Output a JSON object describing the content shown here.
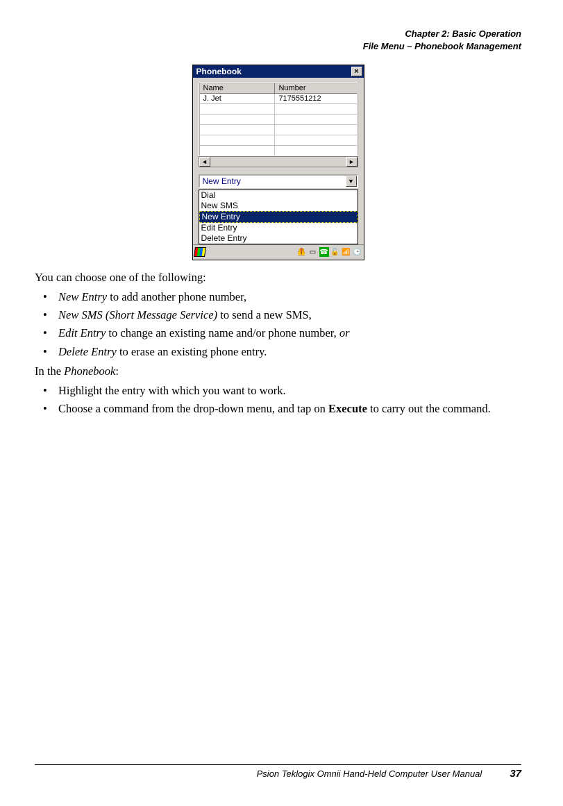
{
  "header": {
    "line1": "Chapter 2: Basic Operation",
    "line2": "File Menu – Phonebook Management"
  },
  "phonebook": {
    "title": "Phonebook",
    "close_glyph": "×",
    "columns": {
      "name": "Name",
      "number": "Number"
    },
    "rows": [
      {
        "name": "J. Jet",
        "number": "7175551212"
      },
      {
        "name": "",
        "number": ""
      },
      {
        "name": "",
        "number": ""
      },
      {
        "name": "",
        "number": ""
      },
      {
        "name": "",
        "number": ""
      },
      {
        "name": "",
        "number": ""
      }
    ],
    "dropdown_value": "New Entry",
    "list": [
      {
        "label": "Dial",
        "selected": false
      },
      {
        "label": "New SMS",
        "selected": false
      },
      {
        "label": "New Entry",
        "selected": true
      },
      {
        "label": "Edit Entry",
        "selected": false
      },
      {
        "label": "Delete Entry",
        "selected": false
      }
    ],
    "arrows": {
      "left": "◄",
      "right": "►",
      "down": "▼"
    },
    "tray_icons": [
      "💻",
      "card-icon",
      "📞",
      "🔒",
      "📶",
      "🕒"
    ]
  },
  "body": {
    "intro": "You can choose one of the following:",
    "bullets1": [
      {
        "em": "New Entry",
        "rest": " to add another phone number,"
      },
      {
        "em": "New SMS (Short Message Service)",
        "rest": " to send a new SMS,"
      },
      {
        "em": "Edit Entry",
        "rest": " to change an existing name and/or phone number, ",
        "tail_em": "or"
      },
      {
        "em": "Delete Entry",
        "rest": " to erase an existing phone entry."
      }
    ],
    "sub_intro_pre": "In the ",
    "sub_intro_em": "Phonebook",
    "sub_intro_post": ":",
    "bullets2": [
      {
        "text": "Highlight the entry with which you want to work."
      },
      {
        "pre": "Choose a command from the drop-down menu, and tap on ",
        "bold": "Execute",
        "post": " to carry out the command."
      }
    ]
  },
  "footer": {
    "manual": "Psion Teklogix Omnii Hand-Held Computer User Manual",
    "page": "37"
  }
}
